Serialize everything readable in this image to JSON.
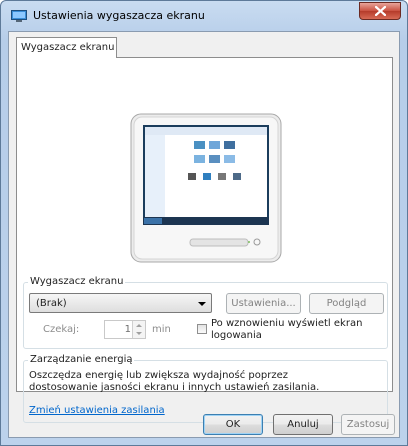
{
  "window": {
    "title": "Ustawienia wygaszacza ekranu",
    "close_label": "Zamknij",
    "tab_label": "Wygaszacz ekranu"
  },
  "screensaver": {
    "group_title": "Wygaszacz ekranu",
    "selected": "(Brak)",
    "settings_button": "Ustawienia...",
    "preview_button": "Podgląd",
    "wait_label": "Czekaj:",
    "wait_value": "1",
    "wait_unit": "min",
    "resume_label": "Po wznowieniu wyświetl ekran logowania",
    "resume_checked": false
  },
  "power": {
    "group_title": "Zarządzanie energią",
    "description": "Oszczędza energię lub zwiększa wydajność poprzez dostosowanie jasności ekranu i innych ustawień zasilania.",
    "link": "Zmień ustawienia zasilania"
  },
  "buttons": {
    "ok": "OK",
    "cancel": "Anuluj",
    "apply": "Zastosuj"
  },
  "icons": {
    "title_icon": "screensaver-monitor-icon",
    "close_icon": "close-icon"
  }
}
